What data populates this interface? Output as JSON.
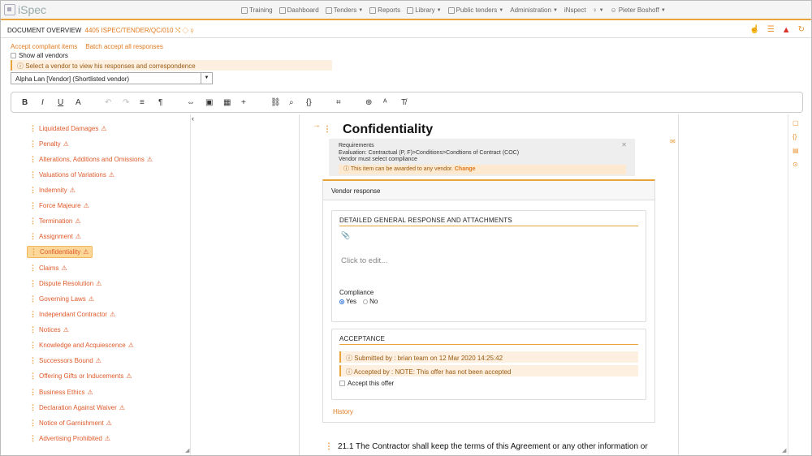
{
  "app": {
    "name": "iSpec"
  },
  "nav": {
    "items": [
      {
        "label": "Training"
      },
      {
        "label": "Dashboard"
      },
      {
        "label": "Tenders"
      },
      {
        "label": "Reports"
      },
      {
        "label": "Library"
      },
      {
        "label": "Public tenders"
      },
      {
        "label": "Administration"
      },
      {
        "label": "iNspect"
      },
      {
        "label": "Pieter Boshoff"
      }
    ]
  },
  "doc": {
    "title": "DOCUMENT OVERVIEW",
    "ref": "4405 ISPEC/TENDER/QC/010"
  },
  "actions": {
    "accept_compliant": "Accept compliant items",
    "batch_accept": "Batch accept all responses",
    "show_all_vendors": "Show all vendors",
    "vendor_note": "Select a vendor to view his responses and correspondence",
    "vendor_selected": "Alpha Lan [Vendor] (Shortlisted vendor)"
  },
  "toolbar": {
    "bold": "B",
    "italic": "I",
    "underline": "U",
    "font": "A",
    "undo": "↶",
    "redo": "↷",
    "align": "≡",
    "para": "¶",
    "link": "⇔",
    "image": "▣",
    "table": "▦",
    "insert": "+",
    "anchor": "⛓",
    "search": "⌕",
    "code": "{}",
    "select": "⌗",
    "zoom": "⊕",
    "spell": "ᴬ",
    "clear": "T̸"
  },
  "tree": {
    "items": [
      {
        "label": "Liquidated Damages"
      },
      {
        "label": "Penalty"
      },
      {
        "label": "Alterations, Additions and Omissions"
      },
      {
        "label": "Valuations of Variations"
      },
      {
        "label": "Indemnity"
      },
      {
        "label": "Force Majeure"
      },
      {
        "label": "Termination"
      },
      {
        "label": "Assignment"
      },
      {
        "label": "Confidentiality"
      },
      {
        "label": "Claims"
      },
      {
        "label": "Dispute Resolution"
      },
      {
        "label": "Governing Laws"
      },
      {
        "label": "Independant Contractor"
      },
      {
        "label": "Notices"
      },
      {
        "label": "Knowledge and Acquiescence"
      },
      {
        "label": "Successors Bound"
      },
      {
        "label": "Offering Gifts or Inducements"
      },
      {
        "label": "Business Ethics"
      },
      {
        "label": "Declaration Against Waiver"
      },
      {
        "label": "Notice of Garnishment"
      },
      {
        "label": "Advertising Prohibited"
      }
    ]
  },
  "section": {
    "heading": "Confidentiality",
    "req_title": "Requirements",
    "req_eval": "Evaluation: Contractual (P, F)>Conditions>Condtions of Contract (COC)",
    "req_compliance": "Vendor must select compliance",
    "award_note": "This item can be awarded to any vendor.",
    "award_change": "Change"
  },
  "vendor_response": {
    "header": "Vendor response",
    "detailed_title": "DETAILED GENERAL RESPONSE AND ATTACHMENTS",
    "click_to_edit": "Click to edit...",
    "compliance_label": "Compliance",
    "yes": "Yes",
    "no": "No",
    "acceptance_title": "ACCEPTANCE",
    "submitted_by": "Submitted by : brian team on 12 Mar 2020 14:25:42",
    "accepted_by": "Accepted by : NOTE: This offer has not been accepted",
    "accept_offer": "Accept this offer",
    "history": "History"
  },
  "clause": {
    "text": "21.1  The Contractor shall keep the terms of this Agreement or any other information or"
  }
}
